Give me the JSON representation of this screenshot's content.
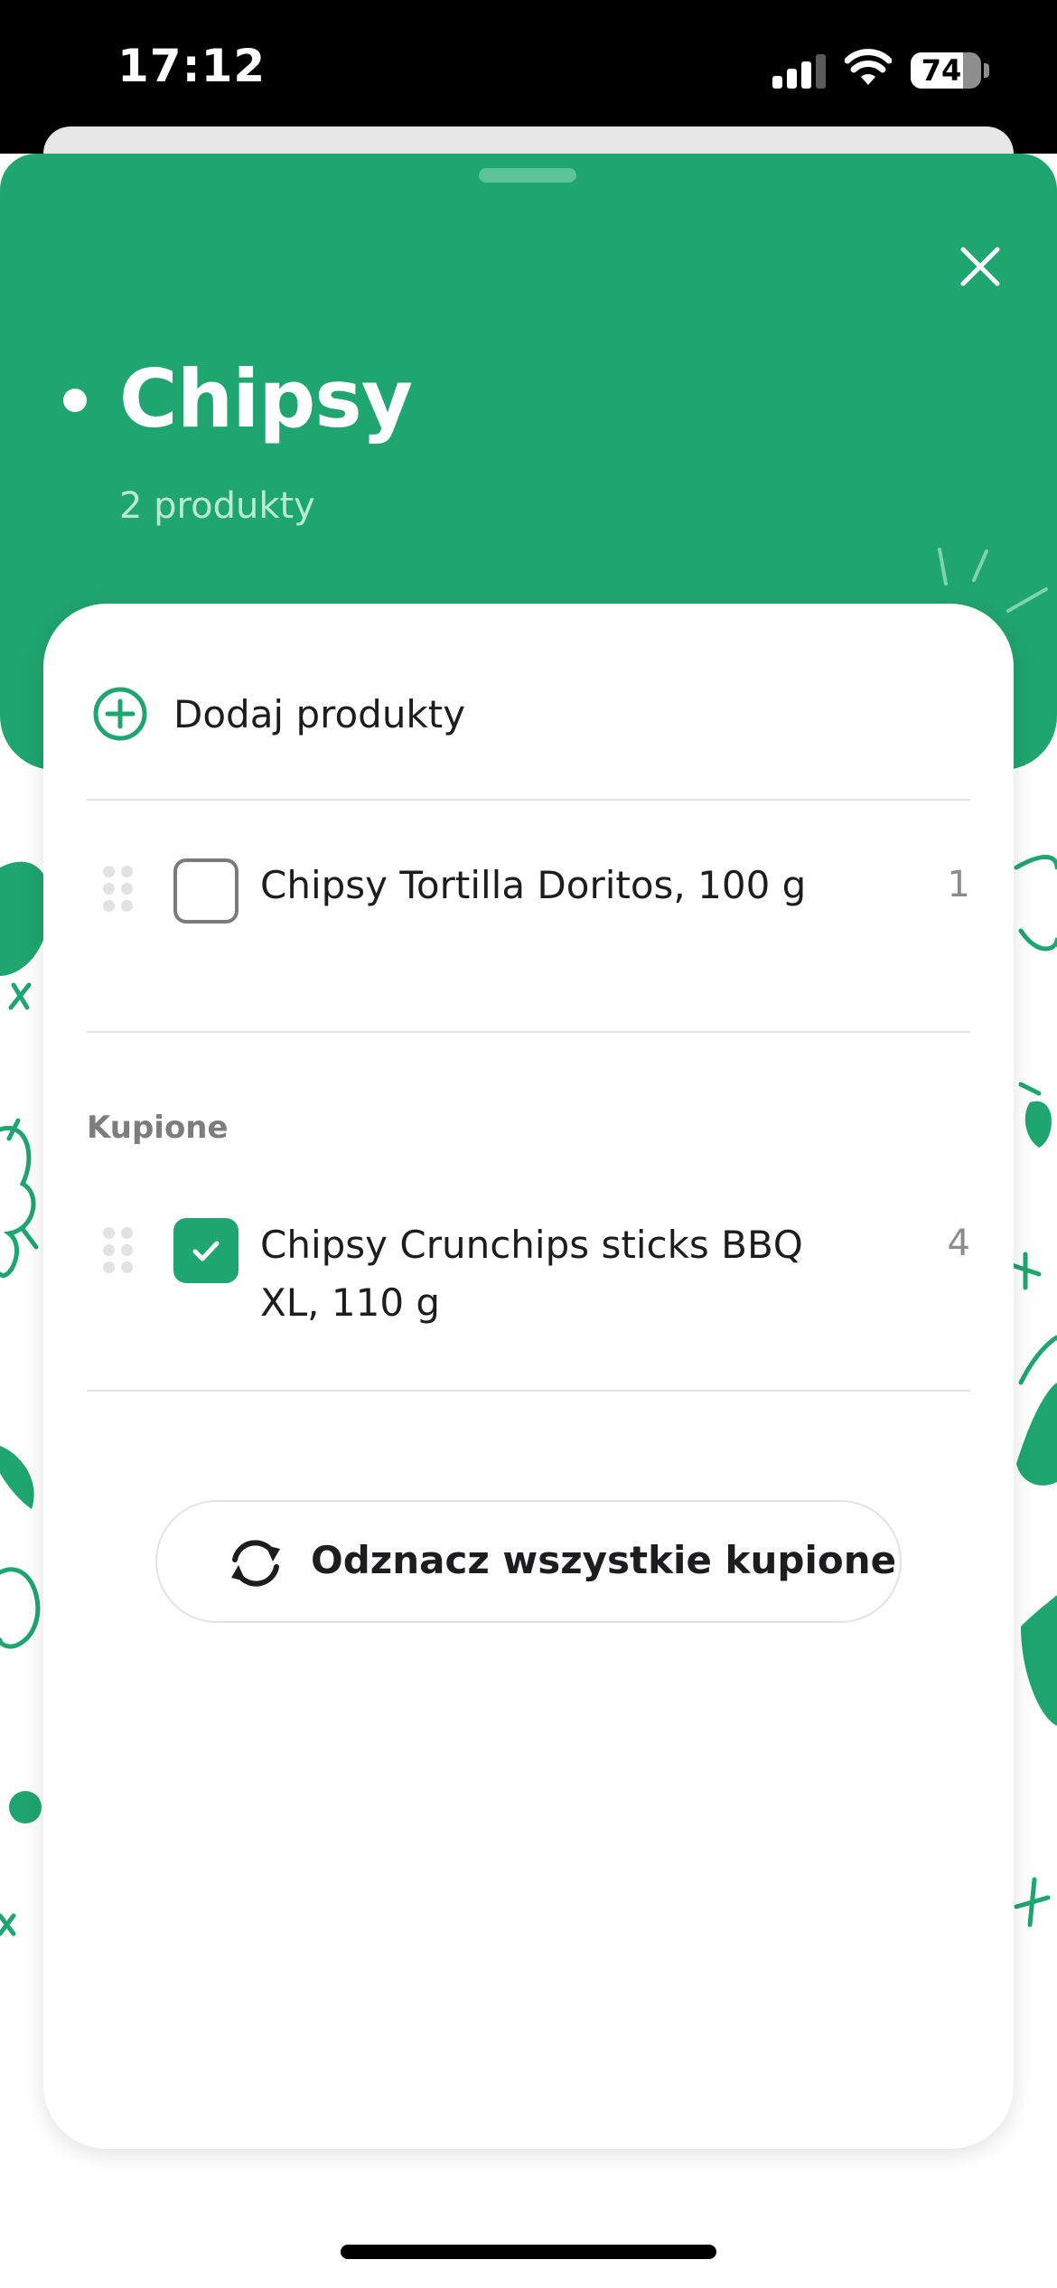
{
  "status_bar": {
    "time": "17:12",
    "battery": "74",
    "battery_level": 0.74
  },
  "sheet": {
    "title": "Chipsy",
    "subtitle": "2 produkty",
    "close_icon": "close-icon"
  },
  "add_products": {
    "label": "Dodaj produkty",
    "icon": "plus-circle-icon"
  },
  "to_buy": [
    {
      "name": "Chipsy Tortilla Doritos, 100 g",
      "qty": "1",
      "checked": false
    }
  ],
  "bought_section": {
    "label": "Kupione",
    "items": [
      {
        "name": "Chipsy Crunchips sticks BBQ XL, 110 g",
        "qty": "4",
        "checked": true
      }
    ]
  },
  "uncheck_all": {
    "label": "Odznacz wszystkie kupione",
    "icon": "refresh-icon"
  },
  "colors": {
    "accent": "#1fa56f",
    "subtitle": "#b8ead2",
    "muted": "#8c8c8c"
  }
}
